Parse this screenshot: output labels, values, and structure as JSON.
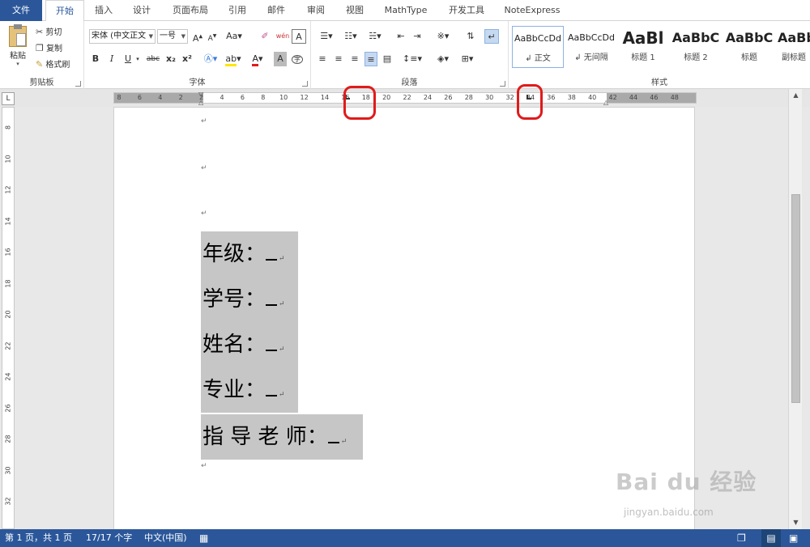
{
  "tabs": [
    "文件",
    "开始",
    "插入",
    "设计",
    "页面布局",
    "引用",
    "邮件",
    "审阅",
    "视图",
    "MathType",
    "开发工具",
    "NoteExpress"
  ],
  "clipboard": {
    "paste": "粘贴",
    "cut": "剪切",
    "copy": "复制",
    "format_painter": "格式刷",
    "label": "剪贴板"
  },
  "font": {
    "name": "宋体 (中文正文",
    "size": "一号",
    "label": "字体",
    "buttons": [
      "B",
      "I",
      "U",
      "abc",
      "x₂",
      "x²"
    ]
  },
  "paragraph": {
    "label": "段落"
  },
  "styles": {
    "label": "样式",
    "items": [
      {
        "sample": "AaBbCcDd",
        "name": "↲ 正文"
      },
      {
        "sample": "AaBbCcDd",
        "name": "↲ 无间隔"
      },
      {
        "sample": "AaBl",
        "name": "标题 1"
      },
      {
        "sample": "AaBbC",
        "name": "标题 2"
      },
      {
        "sample": "AaBbC",
        "name": "标题"
      },
      {
        "sample": "AaBb",
        "name": "副标题"
      }
    ]
  },
  "ruler": {
    "corner": "L",
    "labels": [
      "8",
      "6",
      "4",
      "2",
      "2",
      "4",
      "6",
      "8",
      "10",
      "12",
      "14",
      "16",
      "18",
      "20",
      "22",
      "24",
      "26",
      "28",
      "30",
      "32",
      "34",
      "36",
      "38",
      "40",
      "42",
      "44",
      "46",
      "48"
    ]
  },
  "vruler": {
    "labels": [
      "8",
      "10",
      "12",
      "14",
      "16",
      "18",
      "20",
      "22",
      "24",
      "26",
      "28",
      "30",
      "32"
    ]
  },
  "document": {
    "lines": [
      "年级：",
      "学号：",
      "姓名：",
      "专业：",
      "指 导 老 师："
    ],
    "para_mark": "↵"
  },
  "status": {
    "page": "第 1 页，共 1 页",
    "words": "17/17 个字",
    "language": "中文(中国)"
  },
  "watermark": {
    "logo": "Bai du 经验",
    "url": "jingyan.baidu.com"
  }
}
